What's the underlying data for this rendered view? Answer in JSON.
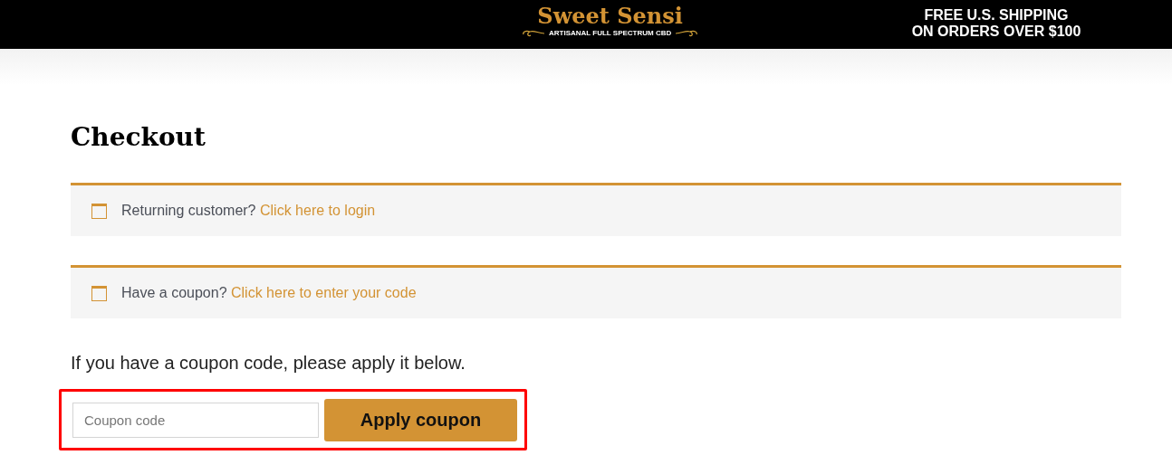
{
  "header": {
    "brand": "Sweet Sensi",
    "tagline": "ARTISANAL FULL SPECTRUM CBD",
    "shipping_lines": [
      "FREE U.S. SHIPPING",
      "ON ORDERS OVER $100"
    ]
  },
  "title": "Checkout",
  "notices": [
    {
      "text": "Returning customer?",
      "link": "Click here to login"
    },
    {
      "text": "Have a coupon?",
      "link": "Click here to enter your code"
    }
  ],
  "coupon_prompt": "If you have a coupon code, please apply it below.",
  "coupon_form": {
    "placeholder": "Coupon code",
    "button": "Apply coupon",
    "highlighted": true
  }
}
